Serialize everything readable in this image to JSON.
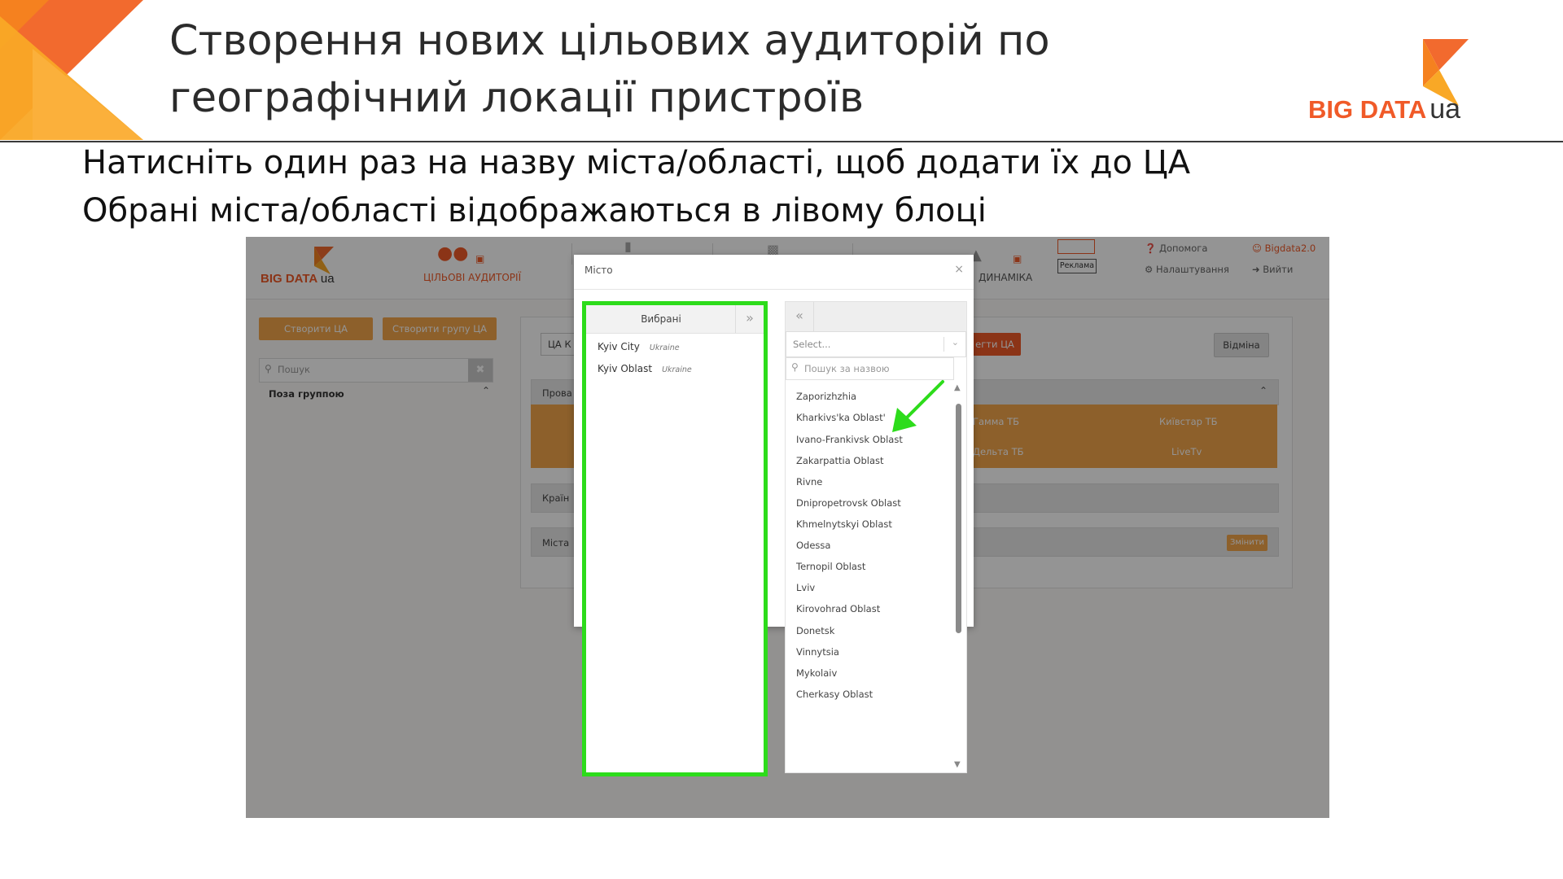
{
  "slide": {
    "title_line1": "Створення нових цільових аудиторій по",
    "title_line2": "географічний локації пристроїв",
    "logo_text": "BIG DATA",
    "logo_ua": "ua",
    "instruction_line1": "Натисніть один раз на назву міста/області, щоб додати їх до ЦА",
    "instruction_line2": "Обрані міста/області відображаються в лівому блоці"
  },
  "app": {
    "logo_text": "BIG DATA",
    "logo_ua": "ua",
    "nav": {
      "audiences": "ЦІЛЬОВІ АУДИТОРІЇ",
      "dynamics": "ДИНАМІКА",
      "ads": "Реклама"
    },
    "top_links": {
      "help": "Допомога",
      "settings": "Налаштування",
      "user": "Bigdata2.0",
      "logout": "Вийти"
    },
    "sidebar": {
      "create_ta": "Створити ЦА",
      "create_group": "Створити групу ЦА",
      "search_placeholder": "Пошук",
      "group_label": "Поза группою"
    },
    "panel": {
      "ta_label": "ЦА К",
      "save_btn": "егти ЦА",
      "cancel_btn": "Відміна",
      "providers_label": "Прова",
      "countries_label": "Країн",
      "cities_label": "Міста",
      "change_btn": "Змінити",
      "channels": [
        "Гамма ТБ",
        "Київстар ТБ",
        "Дельта ТБ",
        "LiveTv"
      ]
    }
  },
  "modal": {
    "title": "Місто",
    "close": "×",
    "selected_header": "Вибрані",
    "move_right": "»",
    "move_left": "«",
    "selected": [
      {
        "name": "Kyiv City",
        "country": "Ukraine"
      },
      {
        "name": "Kyiv Oblast",
        "country": "Ukraine"
      }
    ],
    "select_placeholder": "Select...",
    "search_placeholder": "Пошук за назвою",
    "options": [
      "Zaporizhzhia",
      "Kharkivs'ka Oblast'",
      "Ivano-Frankivsk Oblast",
      "Zakarpattia Oblast",
      "Rivne",
      "Dnipropetrovsk Oblast",
      "Khmelnytskyi Oblast",
      "Odessa",
      "Ternopil Oblast",
      "Lviv",
      "Kirovohrad Oblast",
      "Donetsk",
      "Vinnytsia",
      "Mykolaiv",
      "Cherkasy Oblast"
    ]
  },
  "colors": {
    "highlight_green": "#2ddc1b",
    "brand_orange": "#f05a28",
    "accent_orange": "#f3a54a"
  }
}
